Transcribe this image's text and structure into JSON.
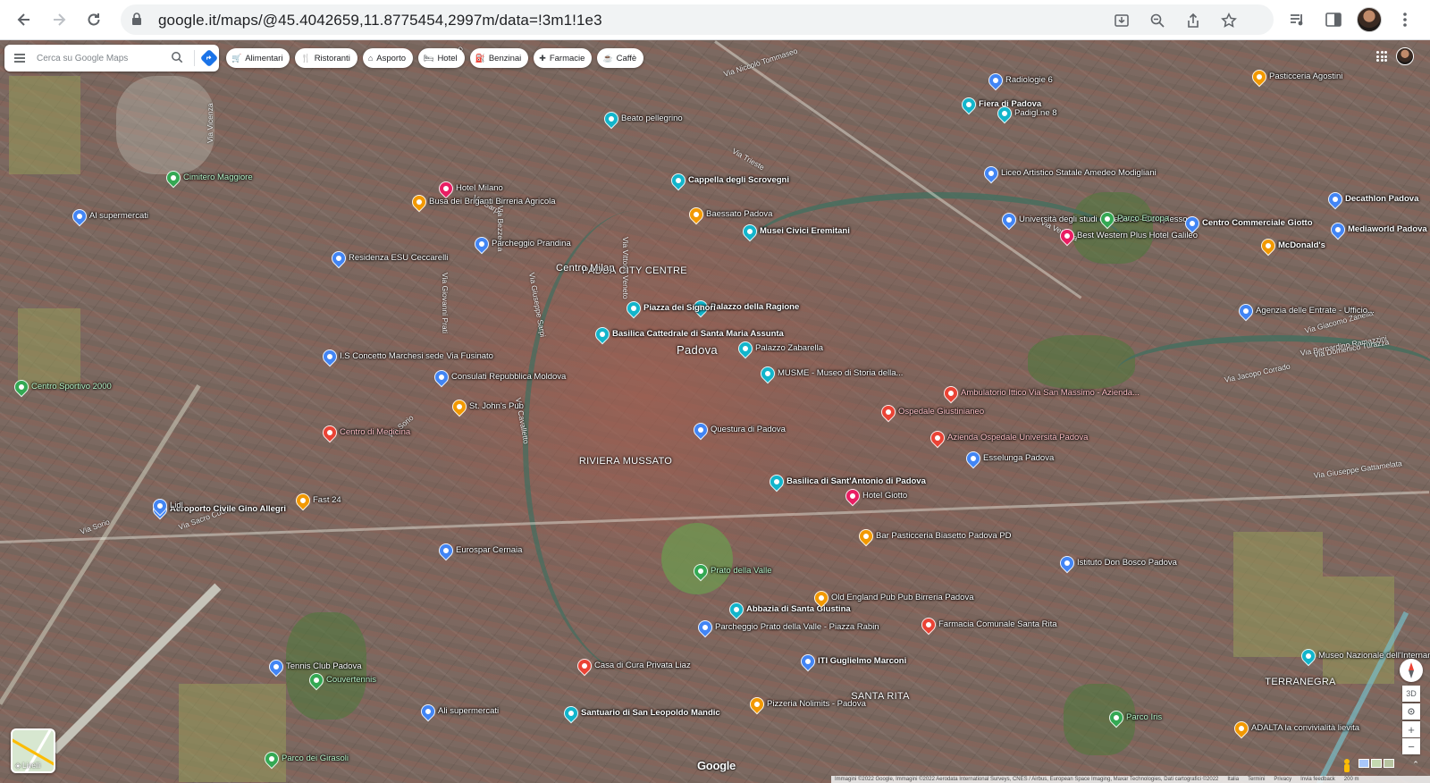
{
  "browser": {
    "url": "google.it/maps/@45.4042659,11.8775454,2997m/data=!3m1!1e3"
  },
  "search": {
    "placeholder": "Cerca su Google Maps",
    "value": ""
  },
  "chips": [
    {
      "label": "Alimentari",
      "icon": "cart-icon"
    },
    {
      "label": "Ristoranti",
      "icon": "restaurant-icon"
    },
    {
      "label": "Asporto",
      "icon": "takeout-icon"
    },
    {
      "label": "Hotel",
      "icon": "hotel-icon"
    },
    {
      "label": "Benzinai",
      "icon": "gas-station-icon"
    },
    {
      "label": "Farmacie",
      "icon": "pharmacy-icon"
    },
    {
      "label": "Caffè",
      "icon": "coffee-icon"
    }
  ],
  "colors": {
    "pin_teal": "#12b5cb",
    "pin_blue": "#4285f4",
    "pin_orange": "#f29900",
    "pin_red": "#ea4335",
    "pin_pink": "#e91e63",
    "pin_green": "#34a853",
    "accent": "#1a73e8"
  },
  "pois": [
    {
      "label": "Cappella degli Scrovegni",
      "color": "pin_teal",
      "bold": true
    },
    {
      "label": "Baessato Padova",
      "color": "pin_orange"
    },
    {
      "label": "Musei Civici Eremitani",
      "color": "pin_teal",
      "bold": true
    },
    {
      "label": "Palazzo della Ragione",
      "color": "pin_teal",
      "bold": true
    },
    {
      "label": "Piazza dei Signori",
      "color": "pin_teal",
      "bold": true
    },
    {
      "label": "Basilica Cattedrale di Santa Maria Assunta",
      "color": "pin_teal",
      "bold": true
    },
    {
      "label": "Palazzo Zabarella",
      "color": "pin_teal"
    },
    {
      "label": "MUSME - Museo di Storia della...",
      "color": "pin_teal"
    },
    {
      "label": "Questura di Padova",
      "color": "pin_blue"
    },
    {
      "label": "Basilica di Sant'Antonio di Padova",
      "color": "pin_teal",
      "bold": true
    },
    {
      "label": "Prato della Valle",
      "color": "pin_green",
      "green": true
    },
    {
      "label": "Abbazia di Santa Giustina",
      "color": "pin_teal",
      "bold": true
    },
    {
      "label": "Parcheggio Prato della Valle - Piazza Rabin",
      "color": "pin_blue"
    },
    {
      "label": "Casa di Cura Privata Liaz",
      "color": "pin_red"
    },
    {
      "label": "Santuario di San Leopoldo Mandic",
      "color": "pin_teal",
      "bold": true
    },
    {
      "label": "Hotel Milano",
      "color": "pin_pink"
    },
    {
      "label": "Busa dei Briganti Birreria Agricola",
      "color": "pin_orange"
    },
    {
      "label": "Parcheggio Prandina",
      "color": "pin_blue"
    },
    {
      "label": "Residenza ESU Ceccarelli",
      "color": "pin_blue"
    },
    {
      "label": "I.S Concetto Marchesi sede Via Fusinato",
      "color": "pin_blue"
    },
    {
      "label": "Consulati Repubblica Moldova",
      "color": "pin_blue"
    },
    {
      "label": "St. John's Pub",
      "color": "pin_orange"
    },
    {
      "label": "Centro di Medicina",
      "color": "pin_red",
      "pink": true
    },
    {
      "label": "Fast 24",
      "color": "pin_orange"
    },
    {
      "label": "Aeroporto Civile Gino Allegri",
      "color": "pin_blue",
      "bold": true
    },
    {
      "label": "Eurospar Cernaia",
      "color": "pin_blue"
    },
    {
      "label": "Tennis Club Padova",
      "color": "pin_blue"
    },
    {
      "label": "Couvertennis",
      "color": "pin_green",
      "green": true
    },
    {
      "label": "Ali supermercati",
      "color": "pin_blue"
    },
    {
      "label": "Parco dei Girasoli",
      "color": "pin_green",
      "green": true
    },
    {
      "label": "Fiera di Padova",
      "color": "pin_teal",
      "bold": true
    },
    {
      "label": "Liceo Artistico Statale Amedeo Modigliani",
      "color": "pin_blue"
    },
    {
      "label": "Università degli studi di Padova - Complesso...",
      "color": "pin_blue"
    },
    {
      "label": "Best Western Plus Hotel Galileo",
      "color": "pin_pink"
    },
    {
      "label": "Centro Commerciale Giotto",
      "color": "pin_blue",
      "bold": true
    },
    {
      "label": "McDonald's",
      "color": "pin_orange",
      "bold": true
    },
    {
      "label": "Decathlon Padova",
      "color": "pin_blue",
      "bold": true
    },
    {
      "label": "Mediaworld Padova",
      "color": "pin_blue",
      "bold": true
    },
    {
      "label": "Pasticceria Agostini",
      "color": "pin_orange"
    },
    {
      "label": "Agenzia delle Entrate - Ufficio...",
      "color": "pin_blue"
    },
    {
      "label": "Ambulatorio Ittico Via San Massimo - Azienda...",
      "color": "pin_red",
      "pink": true
    },
    {
      "label": "Ospedale Giustinianeo",
      "color": "pin_red",
      "pink": true
    },
    {
      "label": "Azienda Ospedale Università Padova",
      "color": "pin_red",
      "pink": true
    },
    {
      "label": "Hotel Giotto",
      "color": "pin_pink"
    },
    {
      "label": "Bar Pasticceria Biasetto Padova PD",
      "color": "pin_orange"
    },
    {
      "label": "Istituto Don Bosco Padova",
      "color": "pin_blue"
    },
    {
      "label": "Esselunga Padova",
      "color": "pin_blue"
    },
    {
      "label": "Old England Pub Pub Birreria Padova",
      "color": "pin_orange"
    },
    {
      "label": "Farmacia Comunale Santa Rita",
      "color": "pin_red"
    },
    {
      "label": "ITI Guglielmo Marconi",
      "color": "pin_blue",
      "bold": true
    },
    {
      "label": "Pizzeria Nolimits - Padova",
      "color": "pin_orange"
    },
    {
      "label": "Parco Iris",
      "color": "pin_green",
      "green": true
    },
    {
      "label": "Museo Nazionale dell'Internamento",
      "color": "pin_teal"
    },
    {
      "label": "ADALTA la convivialità lievita",
      "color": "pin_orange"
    },
    {
      "label": "Centro Sportivo 2000",
      "color": "pin_green",
      "green": true
    },
    {
      "label": "Lidl",
      "color": "pin_blue"
    },
    {
      "label": "Al supermercati",
      "color": "pin_blue"
    },
    {
      "label": "Cimitero Maggiore",
      "color": "pin_green",
      "green": true
    },
    {
      "label": "Beato pellegrino",
      "color": "pin_teal"
    },
    {
      "label": "Radiologie 6",
      "color": "pin_blue"
    },
    {
      "label": "Padigl.ne 8",
      "color": "pin_teal"
    },
    {
      "label": "Parco Europa",
      "color": "pin_green",
      "green": true
    }
  ],
  "areas": [
    {
      "label": "Padova",
      "city": true
    },
    {
      "label": "PADUA CITY CENTRE"
    },
    {
      "label": "RIVIERA MUSSATO"
    },
    {
      "label": "SANTA RITA"
    },
    {
      "label": "TERRANEGRA"
    },
    {
      "label": "Centro Milan"
    }
  ],
  "streets": [
    "Via Niccolò Tommaseo",
    "Via Trieste",
    "Via Venezia",
    "Via Sorio",
    "Via Giovanni Prati",
    "Via Vicenza",
    "Via Sarpi",
    "Via Bezzecca",
    "Via Goito",
    "Via Giuseppe Sarpi",
    "Via Cavalletto",
    "Via Vittorio Veneto",
    "Via Sacro Cuore",
    "Via Giacomo Zanella",
    "Via Bernardino Ramazzini",
    "Via Domenico Turazza",
    "Via Jacopo Corrado",
    "Via Giuseppe Gattamelata",
    "Via Sorio"
  ],
  "map_controls": {
    "layers_label": "Livelli",
    "tilt_label": "3D",
    "zoom_in": "+",
    "zoom_out": "−"
  },
  "footer": {
    "attribution": "Immagini ©2022 Google, Immagini ©2022 Aerodata International Surveys, CNES / Airbus, European Space Imaging, Maxar Technologies, Dati cartografici ©2022",
    "italia": "Italia",
    "terms": "Termini",
    "privacy": "Privacy",
    "feedback": "Invia feedback",
    "scale": "200 m",
    "logo": "Google"
  }
}
